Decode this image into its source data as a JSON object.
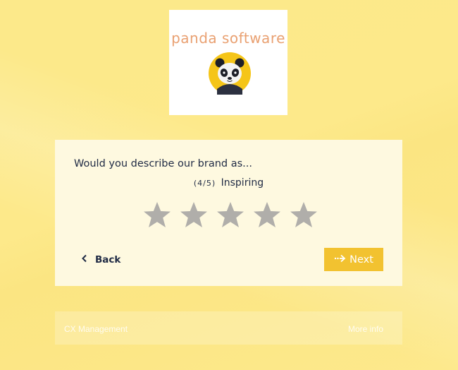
{
  "logo": {
    "text": "panda software",
    "icon": "panda-icon"
  },
  "survey": {
    "question": "Would you describe our brand as...",
    "rating_count": "(4/5)",
    "rating_label": "Inspiring",
    "rating_value": 4,
    "rating_max": 5,
    "star_icon": "star-icon"
  },
  "nav": {
    "back_label": "Back",
    "next_label": "Next"
  },
  "footer": {
    "left_text": "CX Management",
    "right_text": "More info"
  },
  "colors": {
    "background": "#fde98a",
    "card": "#fef9e0",
    "star": "#b0aeaa",
    "next_button": "#f2c230",
    "text": "#1f2a44",
    "logo_text": "#e9a071"
  }
}
